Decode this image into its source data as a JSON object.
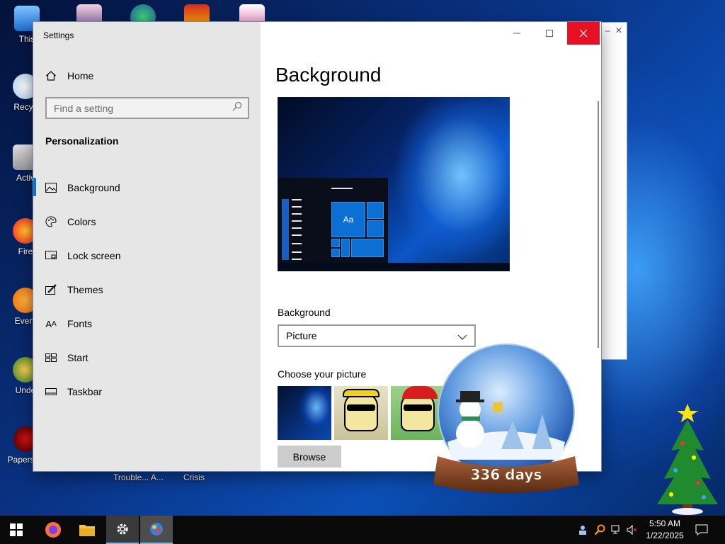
{
  "window": {
    "title": "Settings",
    "controls": {
      "minimize": "minimize",
      "maximize": "maximize",
      "close": "close"
    }
  },
  "sidebar": {
    "home_label": "Home",
    "search_placeholder": "Find a setting",
    "section_title": "Personalization",
    "items": [
      {
        "label": "Background",
        "icon": "picture-icon",
        "selected": true
      },
      {
        "label": "Colors",
        "icon": "palette-icon",
        "selected": false
      },
      {
        "label": "Lock screen",
        "icon": "lock-screen-icon",
        "selected": false
      },
      {
        "label": "Themes",
        "icon": "themes-icon",
        "selected": false
      },
      {
        "label": "Fonts",
        "icon": "fonts-icon",
        "selected": false
      },
      {
        "label": "Start",
        "icon": "start-icon",
        "selected": false
      },
      {
        "label": "Taskbar",
        "icon": "taskbar-icon",
        "selected": false
      }
    ]
  },
  "main": {
    "title": "Background",
    "preview": {
      "tile_text": "Aa"
    },
    "background_label": "Background",
    "background_value": "Picture",
    "choose_label": "Choose your picture",
    "browse_label": "Browse"
  },
  "desktop": {
    "icon_labels": [
      "This",
      "Recyc",
      "Activ",
      "Fire",
      "Every",
      "Unde",
      "Papers, P"
    ],
    "captions": [
      "Trouble... A...",
      "Crisis"
    ],
    "widget_text": "336 days"
  },
  "taskbar": {
    "apps": [
      "start-icon",
      "firefox-icon",
      "file-explorer-icon",
      "settings-icon",
      "app-icon"
    ],
    "time": "5:50 AM",
    "date": "1/22/2025"
  },
  "colors": {
    "accent": "#0078d7",
    "close_hover": "#e81123",
    "sidebar_bg": "#e6e6e6",
    "taskbar_bg": "#0a0a0a"
  }
}
